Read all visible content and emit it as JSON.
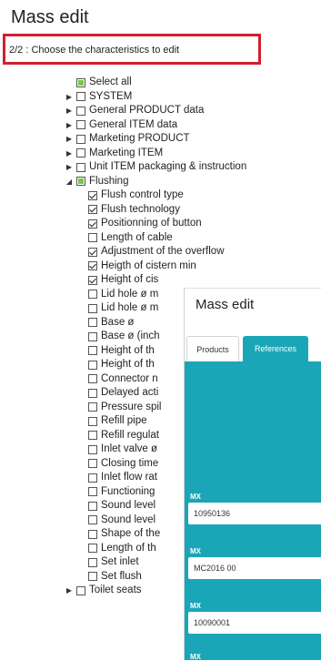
{
  "page": {
    "title": "Mass edit",
    "step": "2/2 : Choose the characteristics to edit"
  },
  "tree": {
    "select_all": "Select all",
    "groups": [
      {
        "label": "SYSTEM"
      },
      {
        "label": "General PRODUCT data"
      },
      {
        "label": "General ITEM data"
      },
      {
        "label": "Marketing PRODUCT"
      },
      {
        "label": "Marketing ITEM"
      },
      {
        "label": "Unit ITEM packaging & instruction"
      }
    ],
    "flushing": {
      "label": "Flushing",
      "items": [
        {
          "label": "Flush control type",
          "checked": true
        },
        {
          "label": "Flush technology",
          "checked": true
        },
        {
          "label": "Positionning of button",
          "checked": true
        },
        {
          "label": "Length of cable",
          "checked": false
        },
        {
          "label": "Adjustment of the overflow",
          "checked": true
        },
        {
          "label": "Heigth of cistern min",
          "checked": true
        },
        {
          "label": "Height of cis",
          "checked": true
        },
        {
          "label": "Lid hole ø m",
          "checked": false
        },
        {
          "label": "Lid hole ø m",
          "checked": false
        },
        {
          "label": "Base ø",
          "checked": false
        },
        {
          "label": "Base ø (inch",
          "checked": false
        },
        {
          "label": "Height of th",
          "checked": false
        },
        {
          "label": "Height of th",
          "checked": false
        },
        {
          "label": "Connector n",
          "checked": false
        },
        {
          "label": "Delayed acti",
          "checked": false
        },
        {
          "label": "Pressure spil",
          "checked": false
        },
        {
          "label": "Refill pipe",
          "checked": false
        },
        {
          "label": "Refill regulat",
          "checked": false
        },
        {
          "label": "Inlet valve ø",
          "checked": false
        },
        {
          "label": "Closing time",
          "checked": false
        },
        {
          "label": "Inlet flow rat",
          "checked": false
        },
        {
          "label": "Functioning",
          "checked": false
        },
        {
          "label": "Sound level",
          "checked": false
        },
        {
          "label": "Sound level",
          "checked": false
        },
        {
          "label": "Shape of the",
          "checked": false
        },
        {
          "label": "Length of th",
          "checked": false
        },
        {
          "label": "Set inlet",
          "checked": false
        },
        {
          "label": "Set flush",
          "checked": false
        }
      ]
    },
    "after": {
      "label": "Toilet seats"
    }
  },
  "overlay": {
    "title": "Mass edit",
    "tabs": {
      "products": "Products",
      "references": "References"
    },
    "mx_label": "MX",
    "references": [
      "10950136",
      "MC2016 00",
      "10090001"
    ],
    "accent_color": "#1aa6b7"
  }
}
